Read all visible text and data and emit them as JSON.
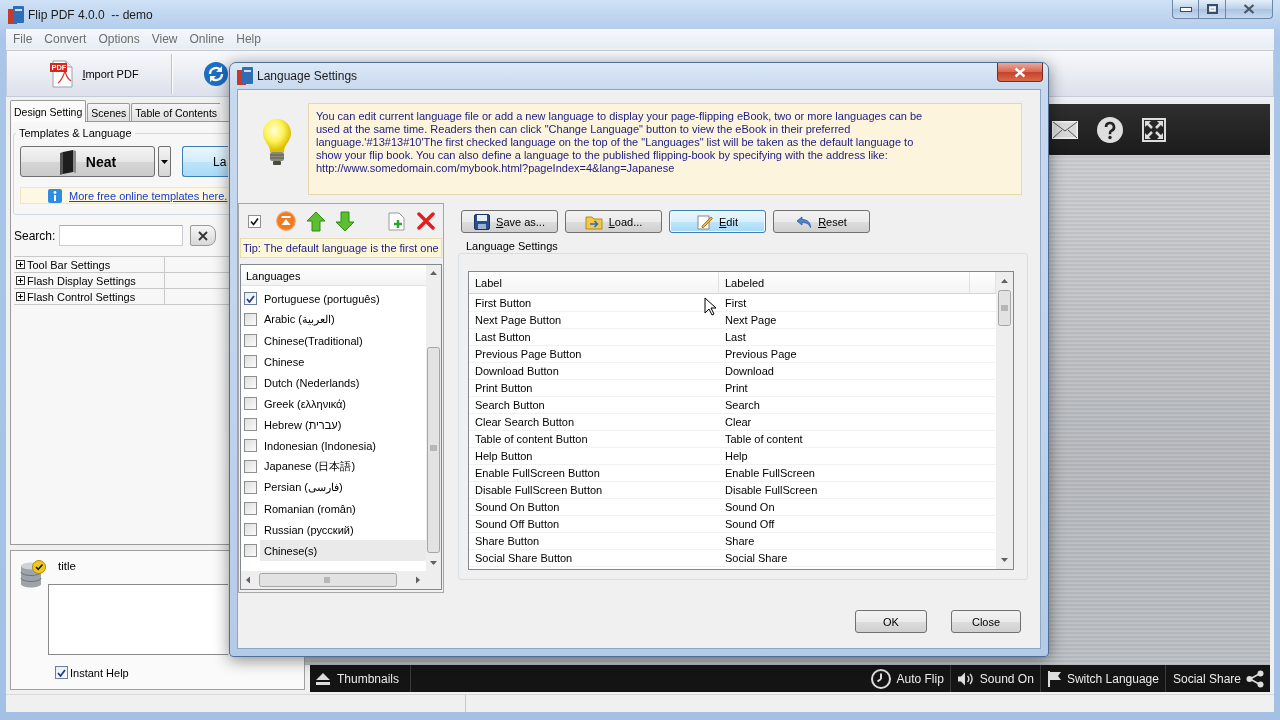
{
  "window": {
    "title": "Flip PDF 4.0.0  -- demo"
  },
  "menu": [
    "File",
    "Convert",
    "Options",
    "View",
    "Online",
    "Help"
  ],
  "toolbar": {
    "import_label": "Import PDF",
    "import_badge": "PDF"
  },
  "left_panel": {
    "tabs": [
      {
        "label": "Design Setting",
        "selected": true
      },
      {
        "label": "Scenes",
        "selected": false
      },
      {
        "label": "Table of Contents",
        "selected": false
      }
    ],
    "group_title": "Templates & Language",
    "template_button": "Neat",
    "language_button": "La",
    "link": "More free online templates here.",
    "search_label": "Search:",
    "tree": [
      {
        "label": "Tool Bar Settings",
        "expanded": false
      },
      {
        "label": "Flash Display Settings",
        "expanded": false
      },
      {
        "label": "Flash Control Settings",
        "expanded": false
      }
    ],
    "help_title": "title",
    "instant_help": {
      "label": "Instant Help",
      "checked": true
    }
  },
  "preview": {
    "bottom_bar": [
      {
        "kind": "thumbnails",
        "label": "Thumbnails"
      },
      {
        "kind": "auto_flip",
        "label": "Auto Flip"
      },
      {
        "kind": "sound",
        "label": "Sound On"
      },
      {
        "kind": "language",
        "label": "Switch Language"
      },
      {
        "kind": "share",
        "label": "Social Share"
      }
    ]
  },
  "dialog": {
    "title": "Language Settings",
    "info": "You can edit current language file or add a new language to display your page-flipping eBook, two or more languages can be used at the same time. Readers then can click \"Change Language\" button to view the eBook in their preferred language.'#13#13#10'The first checked language on the top of the \"Languages\" list will be taken as the default language to show your flip book. You can also define a language to the published flipping-book by specifying with the address like: http://www.somedomain.com/mybook.html?pageIndex=4&lang=Japanese",
    "tip": "Tip: The default language is the first one",
    "languages_header": "Languages",
    "languages": [
      {
        "label": "Portuguese (português)",
        "checked": true,
        "selected": false
      },
      {
        "label": "Arabic (العربية)",
        "checked": false,
        "selected": false
      },
      {
        "label": "Chinese(Traditional)",
        "checked": false,
        "selected": false
      },
      {
        "label": "Chinese",
        "checked": false,
        "selected": false
      },
      {
        "label": "Dutch (Nederlands)",
        "checked": false,
        "selected": false
      },
      {
        "label": "Greek (ελληνικά)",
        "checked": false,
        "selected": false
      },
      {
        "label": "Hebrew (עברית)",
        "checked": false,
        "selected": false
      },
      {
        "label": "Indonesian (Indonesia)",
        "checked": false,
        "selected": false
      },
      {
        "label": "Japanese (日本語)",
        "checked": false,
        "selected": false
      },
      {
        "label": "Persian (فارسی)",
        "checked": false,
        "selected": false
      },
      {
        "label": "Romanian (român)",
        "checked": false,
        "selected": false
      },
      {
        "label": "Russian (русский)",
        "checked": false,
        "selected": false
      },
      {
        "label": "Chinese(s)",
        "checked": false,
        "selected": true
      }
    ],
    "actions": [
      {
        "kind": "save",
        "label": "Save as...",
        "focused": false
      },
      {
        "kind": "load",
        "label": "Load...",
        "focused": false
      },
      {
        "kind": "edit",
        "label": "Edit",
        "focused": true
      },
      {
        "kind": "reset",
        "label": "Reset",
        "focused": false
      }
    ],
    "group_title": "Language Settings",
    "table": {
      "columns": [
        "Label",
        "Labeled"
      ],
      "rows": [
        [
          "First Button",
          "First"
        ],
        [
          "Next Page Button",
          "Next Page"
        ],
        [
          "Last Button",
          "Last"
        ],
        [
          "Previous Page Button",
          "Previous Page"
        ],
        [
          "Download Button",
          "Download"
        ],
        [
          "Print Button",
          "Print"
        ],
        [
          "Search Button",
          "Search"
        ],
        [
          "Clear Search Button",
          "Clear"
        ],
        [
          "Table of content Button",
          "Table of content"
        ],
        [
          "Help Button",
          "Help"
        ],
        [
          "Enable FullScreen Button",
          "Enable FullScreen"
        ],
        [
          "Disable FullScreen Button",
          "Disable FullScreen"
        ],
        [
          "Sound On Button",
          "Sound On"
        ],
        [
          "Sound Off Button",
          "Sound Off"
        ],
        [
          "Share Button",
          "Share"
        ],
        [
          "Social Share Button",
          "Social Share"
        ]
      ]
    },
    "buttons": [
      "OK",
      "Close"
    ]
  }
}
